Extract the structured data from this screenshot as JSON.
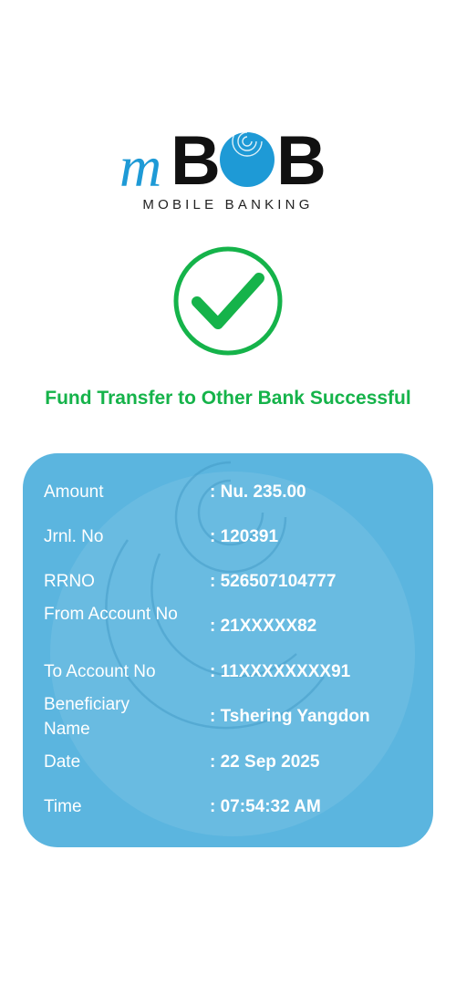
{
  "logo": {
    "brand_prefix": "m",
    "brand_main": "BOB",
    "tagline": "MOBILE BANKING"
  },
  "status": {
    "title": "Fund Transfer to Other Bank Successful",
    "color": "#15b34a"
  },
  "colors": {
    "card": "#5bb5df",
    "brand_blue": "#1e9ad6",
    "success": "#15b34a"
  },
  "details": [
    {
      "label": "Amount",
      "value": "Nu. 235.00"
    },
    {
      "label": "Jrnl. No",
      "value": "120391"
    },
    {
      "label": "RRNO",
      "value": "526507104777"
    },
    {
      "label": "From Account No",
      "value": "21XXXXX82"
    },
    {
      "label": "To Account No",
      "value": "11XXXXXXXX91"
    },
    {
      "label": "Beneficiary Name",
      "value": "Tshering Yangdon"
    },
    {
      "label": "Date",
      "value": "22 Sep 2025"
    },
    {
      "label": "Time",
      "value": "07:54:32 AM"
    }
  ]
}
